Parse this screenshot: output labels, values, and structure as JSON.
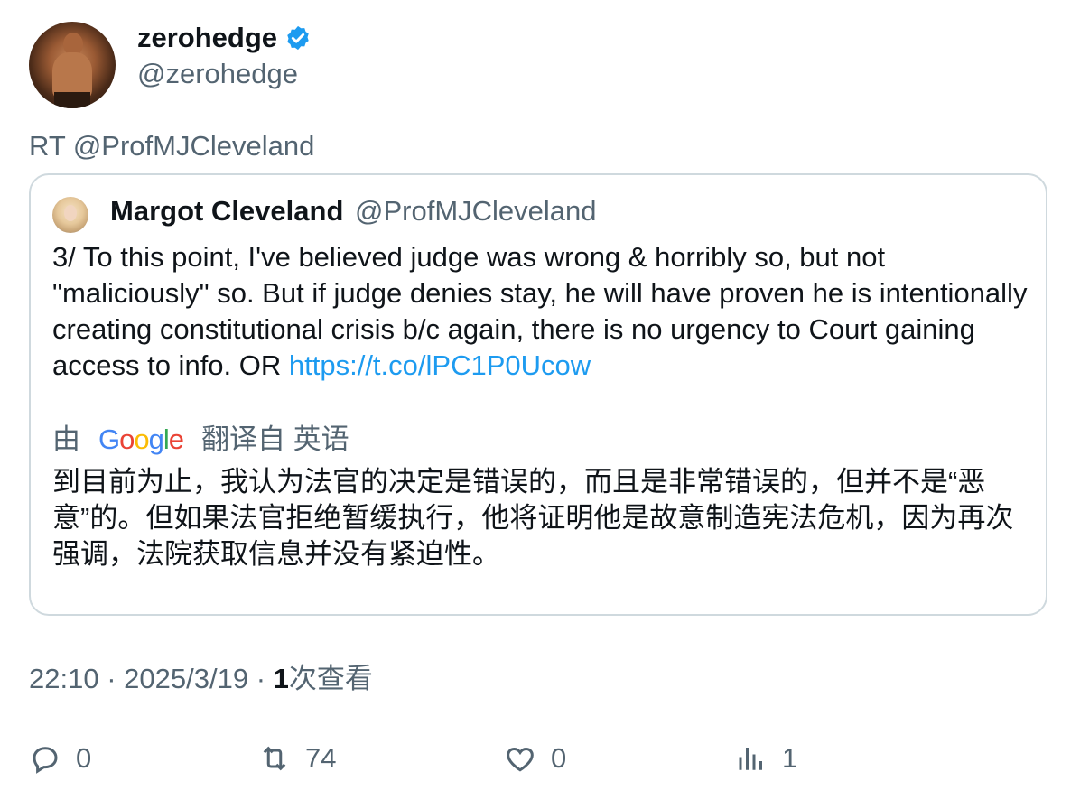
{
  "author": {
    "name": "zerohedge",
    "handle": "@zerohedge",
    "verified_color": "#1d9bf0"
  },
  "retweet_line": "RT @ProfMJCleveland",
  "quote": {
    "name": "Margot Cleveland",
    "handle": "@ProfMJCleveland",
    "text": "3/ To this point, I've believed judge was wrong & horribly so, but not \"maliciously\" so. But if judge denies stay, he will have proven he is intentionally creating constitutional crisis b/c again, there is no urgency to Court gaining access to info. OR ",
    "link": "https://t.co/lPC1P0Ucow",
    "translation": {
      "prefix": "由",
      "brand": "Google",
      "suffix": "翻译自 英语",
      "text": "到目前为止，我认为法官的决定是错误的，而且是非常错误的，但并不是“恶意”的。但如果法官拒绝暂缓执行，他将证明他是故意制造宪法危机，因为再次强调，法院获取信息并没有紧迫性。"
    }
  },
  "meta": {
    "time": "22:10",
    "date": "2025/3/19",
    "views_count": "1",
    "views_label": "次查看",
    "separator": "·"
  },
  "actions": {
    "reply": {
      "icon": "reply-icon",
      "count": "0"
    },
    "retweet": {
      "icon": "retweet-icon",
      "count": "74"
    },
    "like": {
      "icon": "heart-icon",
      "count": "0"
    },
    "views": {
      "icon": "views-chart-icon",
      "count": "1"
    }
  }
}
